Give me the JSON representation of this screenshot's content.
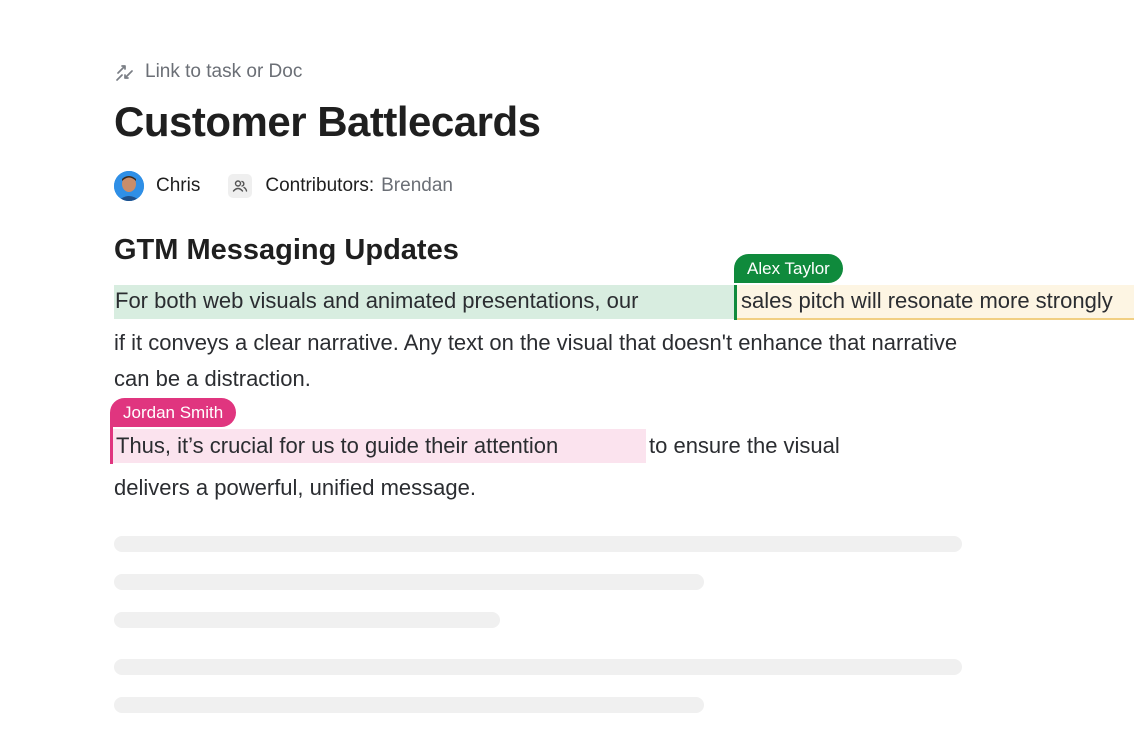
{
  "link": {
    "label": "Link to task or Doc",
    "icon": "link-icon"
  },
  "doc": {
    "title": "Customer Battlecards"
  },
  "meta": {
    "author": "Chris",
    "contributors_label": "Contributors:",
    "contributors_value": "Brendan"
  },
  "section": {
    "heading": "GTM Messaging Updates"
  },
  "collaborators": [
    {
      "name": "Alex Taylor",
      "color": "#0f8a3c"
    },
    {
      "name": "Jordan Smith",
      "color": "#e0357f"
    }
  ],
  "body": {
    "p1_selected": "For both web visuals and animated presentations, our",
    "p1_cont": "sales pitch will resonate more strongly",
    "p1_line2": "if it conveys a clear narrative. Any text on the visual that doesn't enhance that narrative",
    "p1_line3": "can be a distraction.",
    "p2_selected": "Thus, it’s crucial for us to guide their attention",
    "p2_cont": "to ensure the visual",
    "p2_line2": "delivers a powerful, unified message."
  },
  "colors": {
    "green_highlight": "#d8ede0",
    "yellow_highlight": "#fdf5e3",
    "pink_highlight": "#fbe3ee"
  }
}
